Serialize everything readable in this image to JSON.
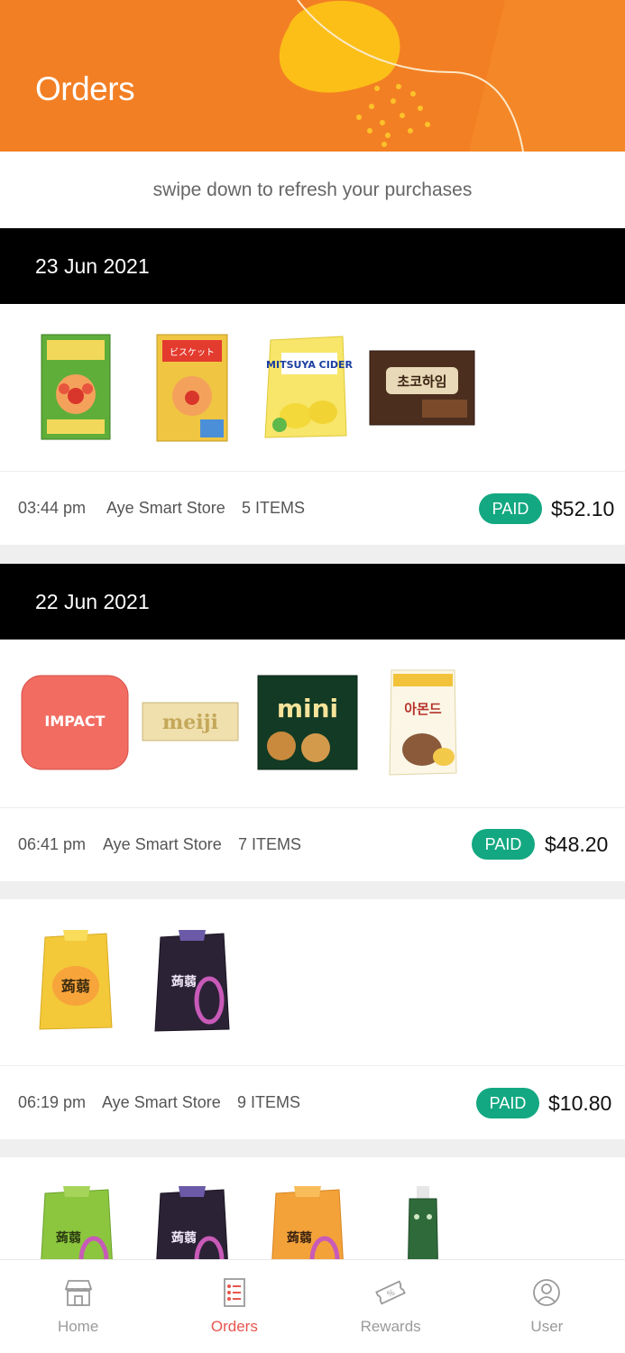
{
  "header": {
    "title": "Orders"
  },
  "hint": "swipe down to refresh your purchases",
  "orders": [
    {
      "date": "23 Jun 2021",
      "time": "03:44 pm",
      "store": "Aye Smart Store",
      "items": "5 ITEMS",
      "status": "PAID",
      "total": "$52.10",
      "products": [
        {
          "name": "anpanman-biscuit-box-1"
        },
        {
          "name": "anpanman-biscuit-box-2",
          "label": "ビスケット"
        },
        {
          "name": "mitsuya-cider-candy",
          "label": "MITSUYA CIDER"
        },
        {
          "name": "choco-heim-box",
          "label": "초코하임"
        }
      ]
    },
    {
      "date": "22 Jun 2021",
      "time": "06:41 pm",
      "store": "Aye Smart Store",
      "items": "7 ITEMS",
      "status": "PAID",
      "total": "$48.20",
      "products": [
        {
          "name": "impact-mint-tin",
          "label": "IMPACT"
        },
        {
          "name": "meiji-chocolate-bar",
          "label": "meiji"
        },
        {
          "name": "digestive-mini-box",
          "label": "mini"
        },
        {
          "name": "almond-snack-pack",
          "label": "아몬드"
        }
      ]
    },
    {
      "date": "",
      "time": "06:19 pm",
      "store": "Aye Smart Store",
      "items": "9 ITEMS",
      "status": "PAID",
      "total": "$10.80",
      "products": [
        {
          "name": "jelly-pouch-mango"
        },
        {
          "name": "jelly-pouch-grape"
        }
      ]
    },
    {
      "products": [
        {
          "name": "jelly-pouch-green"
        },
        {
          "name": "jelly-pouch-grape"
        },
        {
          "name": "jelly-pouch-orange"
        },
        {
          "name": "green-drink-pouch"
        }
      ]
    }
  ],
  "nav": [
    {
      "label": "Home",
      "icon": "store-icon"
    },
    {
      "label": "Orders",
      "icon": "receipt-icon",
      "active": true
    },
    {
      "label": "Rewards",
      "icon": "ticket-icon"
    },
    {
      "label": "User",
      "icon": "user-icon"
    }
  ],
  "colors": {
    "brand": "#f37f24",
    "paid": "#13a881",
    "nav_active": "#e8554e"
  }
}
